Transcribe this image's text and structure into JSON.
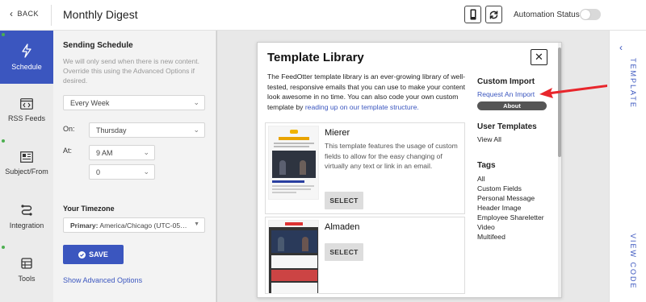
{
  "header": {
    "back_label": "BACK",
    "title": "Monthly Digest",
    "automation_status_label": "Automation Status",
    "automation_status_on": false
  },
  "nav": {
    "items": [
      {
        "label": "Schedule",
        "icon": "lightning-icon",
        "active": true,
        "has_dot": true
      },
      {
        "label": "RSS Feeds",
        "icon": "code-window-icon",
        "active": false,
        "has_dot": false
      },
      {
        "label": "Subject/From",
        "icon": "newspaper-icon",
        "active": false,
        "has_dot": true
      },
      {
        "label": "Integration",
        "icon": "integration-icon",
        "active": false,
        "has_dot": false
      },
      {
        "label": "Tools",
        "icon": "tools-icon",
        "active": false,
        "has_dot": true
      }
    ]
  },
  "schedule": {
    "title": "Sending Schedule",
    "help_text": "We will only send when there is new content. Override this using the Advanced Options if desired.",
    "frequency": "Every Week",
    "on_label": "On:",
    "day": "Thursday",
    "at_label": "At:",
    "hour": "9 AM",
    "minute": "0",
    "timezone_title": "Your Timezone",
    "timezone_prefix": "Primary:",
    "timezone_value": "America/Chicago (UTC-05…",
    "save_label": "SAVE",
    "advanced_link": "Show Advanced Options"
  },
  "rail": {
    "template_label": "TEMPLATE",
    "view_code_label": "VIEW CODE"
  },
  "modal": {
    "title": "Template Library",
    "intro_text": "The FeedOtter template library is an ever-growing library of well-tested, responsive emails that you can use to make your content look awesome in no time. You can also code your own custom template by ",
    "intro_link": "reading up on our template structure.",
    "templates": [
      {
        "name": "Mierer",
        "description": "This template features the usage of custom fields to allow for the easy changing of virtually any text or link in an email.",
        "select_label": "SELECT",
        "thumb_heading": "Your Content Weekly"
      },
      {
        "name": "Almaden",
        "description": "",
        "select_label": "SELECT",
        "thumb_heading": "gartner"
      }
    ],
    "custom_import": {
      "title": "Custom Import",
      "request_link": "Request An Import",
      "about_label": "About"
    },
    "user_templates": {
      "title": "User Templates",
      "view_all": "View All"
    },
    "tags": {
      "title": "Tags",
      "items": [
        "All",
        "Custom Fields",
        "Personal Message",
        "Header Image",
        "Employee Shareletter",
        "Video",
        "Multifeed"
      ]
    }
  },
  "colors": {
    "accent": "#3b56bf",
    "annotation_arrow": "#e8262c"
  }
}
